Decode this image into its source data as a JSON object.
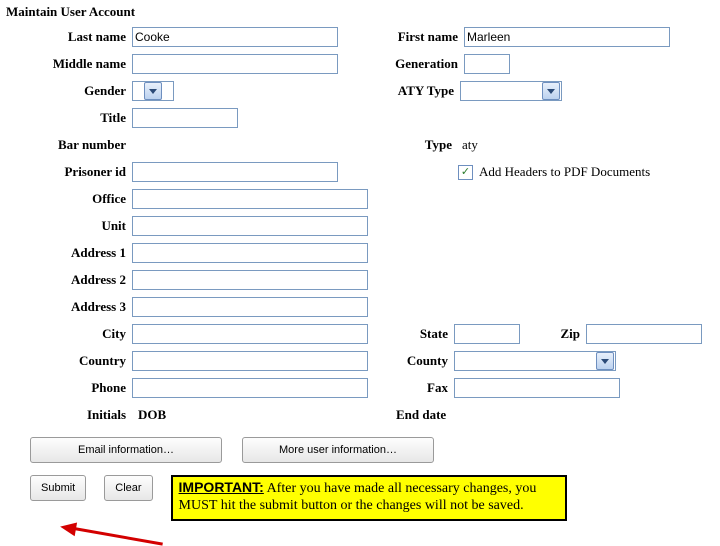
{
  "page_title": "Maintain User Account",
  "fields": {
    "last_name": {
      "label": "Last name",
      "value": "Cooke"
    },
    "first_name": {
      "label": "First name",
      "value": "Marleen"
    },
    "middle_name": {
      "label": "Middle name",
      "value": ""
    },
    "generation": {
      "label": "Generation",
      "value": ""
    },
    "gender": {
      "label": "Gender",
      "value": ""
    },
    "aty_type": {
      "label": "ATY Type",
      "value": ""
    },
    "title": {
      "label": "Title",
      "value": ""
    },
    "bar_number": {
      "label": "Bar number"
    },
    "type": {
      "label": "Type",
      "value": "aty"
    },
    "prisoner_id": {
      "label": "Prisoner id",
      "value": ""
    },
    "add_headers": {
      "label": "Add Headers to PDF Documents",
      "checked": true
    },
    "office": {
      "label": "Office",
      "value": ""
    },
    "unit": {
      "label": "Unit",
      "value": ""
    },
    "address1": {
      "label": "Address 1",
      "value": ""
    },
    "address2": {
      "label": "Address 2",
      "value": ""
    },
    "address3": {
      "label": "Address 3",
      "value": ""
    },
    "city": {
      "label": "City",
      "value": ""
    },
    "state": {
      "label": "State",
      "value": ""
    },
    "zip": {
      "label": "Zip",
      "value": ""
    },
    "country": {
      "label": "Country",
      "value": ""
    },
    "county": {
      "label": "County",
      "value": ""
    },
    "phone": {
      "label": "Phone",
      "value": ""
    },
    "fax": {
      "label": "Fax",
      "value": ""
    },
    "initials": {
      "label": "Initials"
    },
    "dob": {
      "label": "DOB"
    },
    "end_date": {
      "label": "End date"
    }
  },
  "buttons": {
    "email_info": "Email information…",
    "more_user_info": "More user information…",
    "submit": "Submit",
    "clear": "Clear"
  },
  "note": {
    "prefix": "IMPORTANT:",
    "body": "  After you have made all necessary changes, you MUST hit the submit button or the changes will not be saved."
  }
}
